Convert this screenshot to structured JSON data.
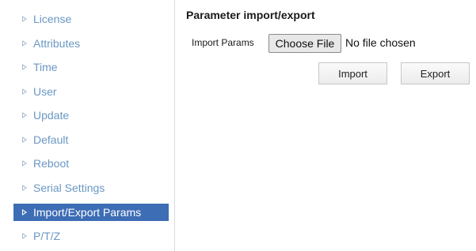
{
  "sidebar": {
    "items": [
      {
        "label": "License",
        "active": false
      },
      {
        "label": "Attributes",
        "active": false
      },
      {
        "label": "Time",
        "active": false
      },
      {
        "label": "User",
        "active": false
      },
      {
        "label": "Update",
        "active": false
      },
      {
        "label": "Default",
        "active": false
      },
      {
        "label": "Reboot",
        "active": false
      },
      {
        "label": "Serial Settings",
        "active": false
      },
      {
        "label": "Import/Export Params",
        "active": true
      },
      {
        "label": "P/T/Z",
        "active": false
      }
    ]
  },
  "main": {
    "title": "Parameter import/export",
    "import_params_label": "Import Params",
    "choose_file_label": "Choose File",
    "file_status": "No file chosen",
    "import_button": "Import",
    "export_button": "Export"
  },
  "colors": {
    "nav_text": "#6a97c4",
    "nav_active_bg": "#3d6db5",
    "nav_active_text": "#ffffff"
  }
}
